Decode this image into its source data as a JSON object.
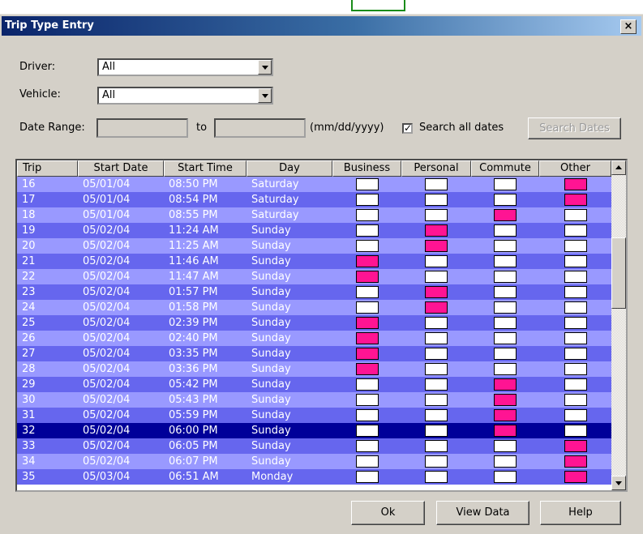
{
  "window": {
    "title": "Trip Type Entry",
    "close_label": "×"
  },
  "filters": {
    "driver_label": "Driver:",
    "driver_value": "All",
    "vehicle_label": "Vehicle:",
    "vehicle_value": "All",
    "date_range_label": "Date Range:",
    "to_label": "to",
    "format_label": "(mm/dd/yyyy)",
    "search_all_label": "Search all dates",
    "search_all_checked": true,
    "search_dates_label": "Search Dates"
  },
  "table": {
    "columns": [
      "Trip",
      "Start Date",
      "Start Time",
      "Day",
      "Business",
      "Personal",
      "Commute",
      "Other"
    ],
    "rows": [
      {
        "trip": "16",
        "date": "05/01/04",
        "time": "08:50 PM",
        "day": "Saturday",
        "type": "Other"
      },
      {
        "trip": "17",
        "date": "05/01/04",
        "time": "08:54 PM",
        "day": "Saturday",
        "type": "Other"
      },
      {
        "trip": "18",
        "date": "05/01/04",
        "time": "08:55 PM",
        "day": "Saturday",
        "type": "Commute"
      },
      {
        "trip": "19",
        "date": "05/02/04",
        "time": "11:24 AM",
        "day": "Sunday",
        "type": "Personal"
      },
      {
        "trip": "20",
        "date": "05/02/04",
        "time": "11:25 AM",
        "day": "Sunday",
        "type": "Personal"
      },
      {
        "trip": "21",
        "date": "05/02/04",
        "time": "11:46 AM",
        "day": "Sunday",
        "type": "Business"
      },
      {
        "trip": "22",
        "date": "05/02/04",
        "time": "11:47 AM",
        "day": "Sunday",
        "type": "Business"
      },
      {
        "trip": "23",
        "date": "05/02/04",
        "time": "01:57 PM",
        "day": "Sunday",
        "type": "Personal"
      },
      {
        "trip": "24",
        "date": "05/02/04",
        "time": "01:58 PM",
        "day": "Sunday",
        "type": "Personal"
      },
      {
        "trip": "25",
        "date": "05/02/04",
        "time": "02:39 PM",
        "day": "Sunday",
        "type": "Business"
      },
      {
        "trip": "26",
        "date": "05/02/04",
        "time": "02:40 PM",
        "day": "Sunday",
        "type": "Business"
      },
      {
        "trip": "27",
        "date": "05/02/04",
        "time": "03:35 PM",
        "day": "Sunday",
        "type": "Business"
      },
      {
        "trip": "28",
        "date": "05/02/04",
        "time": "03:36 PM",
        "day": "Sunday",
        "type": "Business"
      },
      {
        "trip": "29",
        "date": "05/02/04",
        "time": "05:42 PM",
        "day": "Sunday",
        "type": "Commute"
      },
      {
        "trip": "30",
        "date": "05/02/04",
        "time": "05:43 PM",
        "day": "Sunday",
        "type": "Commute"
      },
      {
        "trip": "31",
        "date": "05/02/04",
        "time": "05:59 PM",
        "day": "Sunday",
        "type": "Commute"
      },
      {
        "trip": "32",
        "date": "05/02/04",
        "time": "06:00 PM",
        "day": "Sunday",
        "type": "Commute",
        "selected": true
      },
      {
        "trip": "33",
        "date": "05/02/04",
        "time": "06:05 PM",
        "day": "Sunday",
        "type": "Other"
      },
      {
        "trip": "34",
        "date": "05/02/04",
        "time": "06:07 PM",
        "day": "Sunday",
        "type": "Other"
      },
      {
        "trip": "35",
        "date": "05/03/04",
        "time": "06:51 AM",
        "day": "Monday",
        "type": "Other"
      }
    ]
  },
  "buttons": {
    "ok": "Ok",
    "view_data": "View Data",
    "help": "Help"
  },
  "colors": {
    "row_light": "#9999ff",
    "row_dark": "#6666ee",
    "row_selected": "#000099",
    "checked": "#ff1493",
    "title_start": "#0a246a"
  }
}
